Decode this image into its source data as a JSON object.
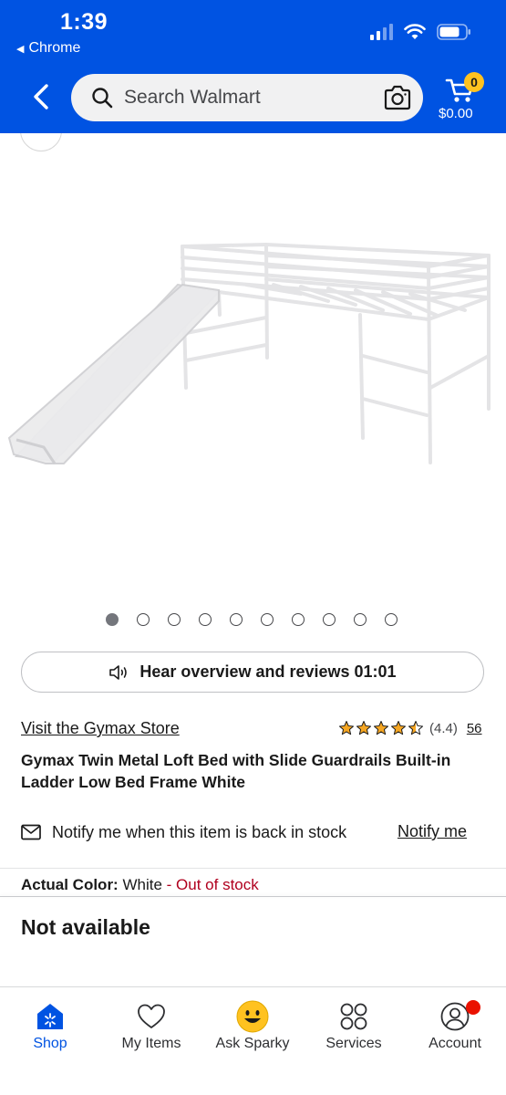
{
  "status_bar": {
    "time": "1:39",
    "back_app": "Chrome"
  },
  "header": {
    "search_placeholder": "Search Walmart",
    "cart_count": "0",
    "cart_total": "$0.00",
    "brand_color": "#0053e2"
  },
  "gallery": {
    "image_count": 10,
    "active_index": 0
  },
  "audio_button": {
    "label": "Hear overview and reviews 01:01"
  },
  "product": {
    "store_link": "Visit the Gymax Store",
    "rating_value": "(4.4)",
    "rating_stars": 4.4,
    "review_count": "56",
    "title": "Gymax Twin Metal Loft Bed with Slide Guardrails Built-in Ladder Low Bed Frame White"
  },
  "notify": {
    "text": "Notify me when this item is back in stock",
    "link": "Notify me"
  },
  "variant": {
    "label": "Actual Color:",
    "value": "White",
    "stock_status": "- Out of stock",
    "stock_color": "#b0001e"
  },
  "availability": {
    "text": "Not available"
  },
  "bottom_nav": {
    "items": [
      {
        "label": "Shop",
        "icon": "shop-icon",
        "active": true
      },
      {
        "label": "My Items",
        "icon": "heart-icon",
        "active": false
      },
      {
        "label": "Ask Sparky",
        "icon": "sparky-icon",
        "active": false
      },
      {
        "label": "Services",
        "icon": "services-grid-icon",
        "active": false
      },
      {
        "label": "Account",
        "icon": "account-icon",
        "active": false
      }
    ]
  }
}
